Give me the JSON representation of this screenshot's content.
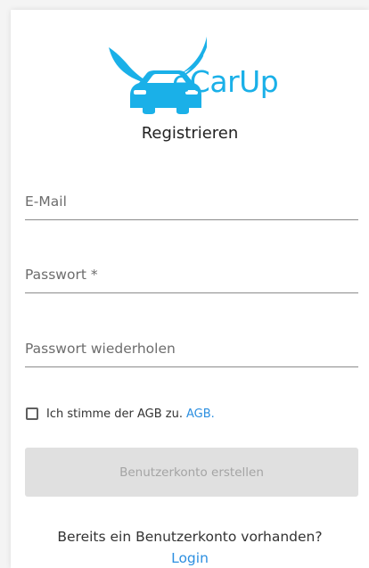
{
  "logo": {
    "text": "eCarUp",
    "icon": "winged-car-logo",
    "color": "#1ab0e8"
  },
  "title": "Registrieren",
  "form": {
    "email_placeholder": "E-Mail",
    "password_placeholder": "Passwort *",
    "password_repeat_placeholder": "Passwort wiederholen",
    "agb": {
      "checked": false,
      "label": "Ich stimme der AGB zu.",
      "link_text": "AGB."
    },
    "submit_label": "Benutzerkonto erstellen"
  },
  "footer": {
    "hint": "Bereits ein Benutzerkonto vorhanden?",
    "login_link": "Login"
  },
  "colors": {
    "accent": "#1ab0e8",
    "link": "#2c8fe0",
    "disabled_button_bg": "#e0e0e0",
    "disabled_button_text": "#a4a4a4"
  }
}
